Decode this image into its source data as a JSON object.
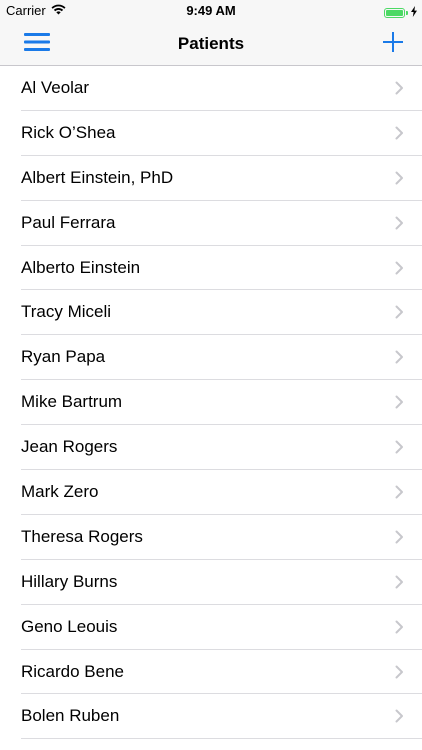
{
  "status_bar": {
    "carrier": "Carrier",
    "time": "9:49 AM",
    "battery_level": 1.0,
    "battery_color": "#4cd964"
  },
  "nav_bar": {
    "title": "Patients",
    "left_icon": "hamburger-menu-icon",
    "right_icon": "plus-icon",
    "accent_color": "#1a7ae8"
  },
  "patients": [
    {
      "name": "Al Veolar"
    },
    {
      "name": "Rick O’Shea"
    },
    {
      "name": "Albert Einstein, PhD"
    },
    {
      "name": "Paul Ferrara"
    },
    {
      "name": "Alberto Einstein"
    },
    {
      "name": "Tracy Miceli"
    },
    {
      "name": "Ryan Papa"
    },
    {
      "name": "Mike Bartrum"
    },
    {
      "name": "Jean Rogers"
    },
    {
      "name": "Mark Zero"
    },
    {
      "name": "Theresa Rogers"
    },
    {
      "name": "Hillary Burns"
    },
    {
      "name": "Geno Leouis"
    },
    {
      "name": "Ricardo Bene"
    },
    {
      "name": "Bolen Ruben"
    }
  ]
}
